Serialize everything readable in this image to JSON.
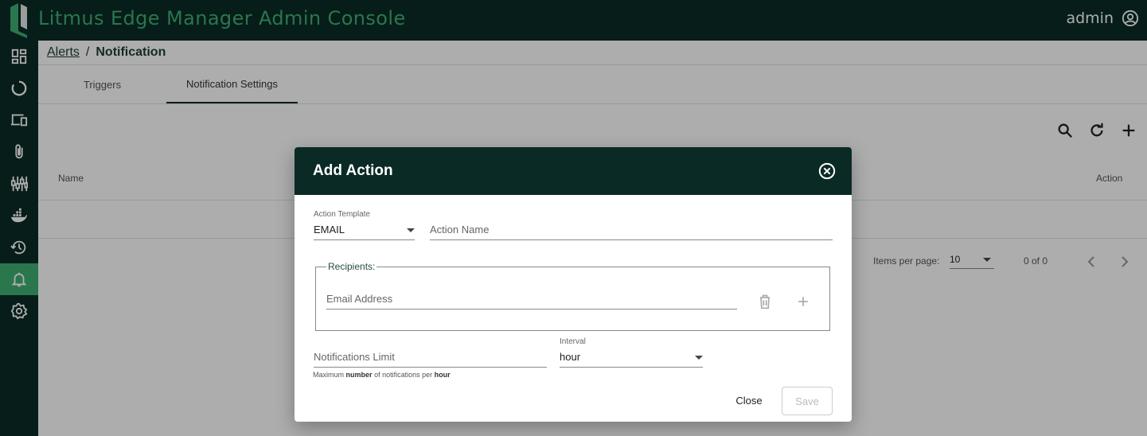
{
  "header": {
    "title": "Litmus Edge Manager Admin Console",
    "user": "admin"
  },
  "sidebar": {
    "items": [
      {
        "icon": "dashboard-icon",
        "active": false
      },
      {
        "icon": "circle-refresh-icon",
        "active": false
      },
      {
        "icon": "devices-icon",
        "active": false
      },
      {
        "icon": "paperclip-icon",
        "active": false
      },
      {
        "icon": "equalizer-icon",
        "active": false
      },
      {
        "icon": "docker-icon",
        "active": false
      },
      {
        "icon": "history-icon",
        "active": false
      },
      {
        "icon": "bell-icon",
        "active": true
      },
      {
        "icon": "gear-icon",
        "active": false
      }
    ]
  },
  "breadcrumb": {
    "parent": "Alerts",
    "separator": "/",
    "current": "Notification"
  },
  "tabs": [
    {
      "label": "Triggers",
      "active": false
    },
    {
      "label": "Notification Settings",
      "active": true
    }
  ],
  "table": {
    "columns": [
      "Name",
      "Action"
    ]
  },
  "pagination": {
    "items_per_page_label": "Items per page:",
    "items_per_page": "10",
    "range": "0 of 0"
  },
  "dialog": {
    "title": "Add Action",
    "action_template_label": "Action Template",
    "action_template_value": "EMAIL",
    "action_name_placeholder": "Action Name",
    "recipients_label": "Recipients:",
    "email_placeholder": "Email Address",
    "notifications_limit_placeholder": "Notifications Limit",
    "interval_label": "Interval",
    "interval_value": "hour",
    "hint_prefix": "Maximum",
    "hint_bold1": "number",
    "hint_middle": "of notifications per",
    "hint_bold2": "hour",
    "close_label": "Close",
    "save_label": "Save"
  },
  "colors": {
    "brand_dark": "#0a2b25",
    "brand_green": "#3fae72"
  }
}
